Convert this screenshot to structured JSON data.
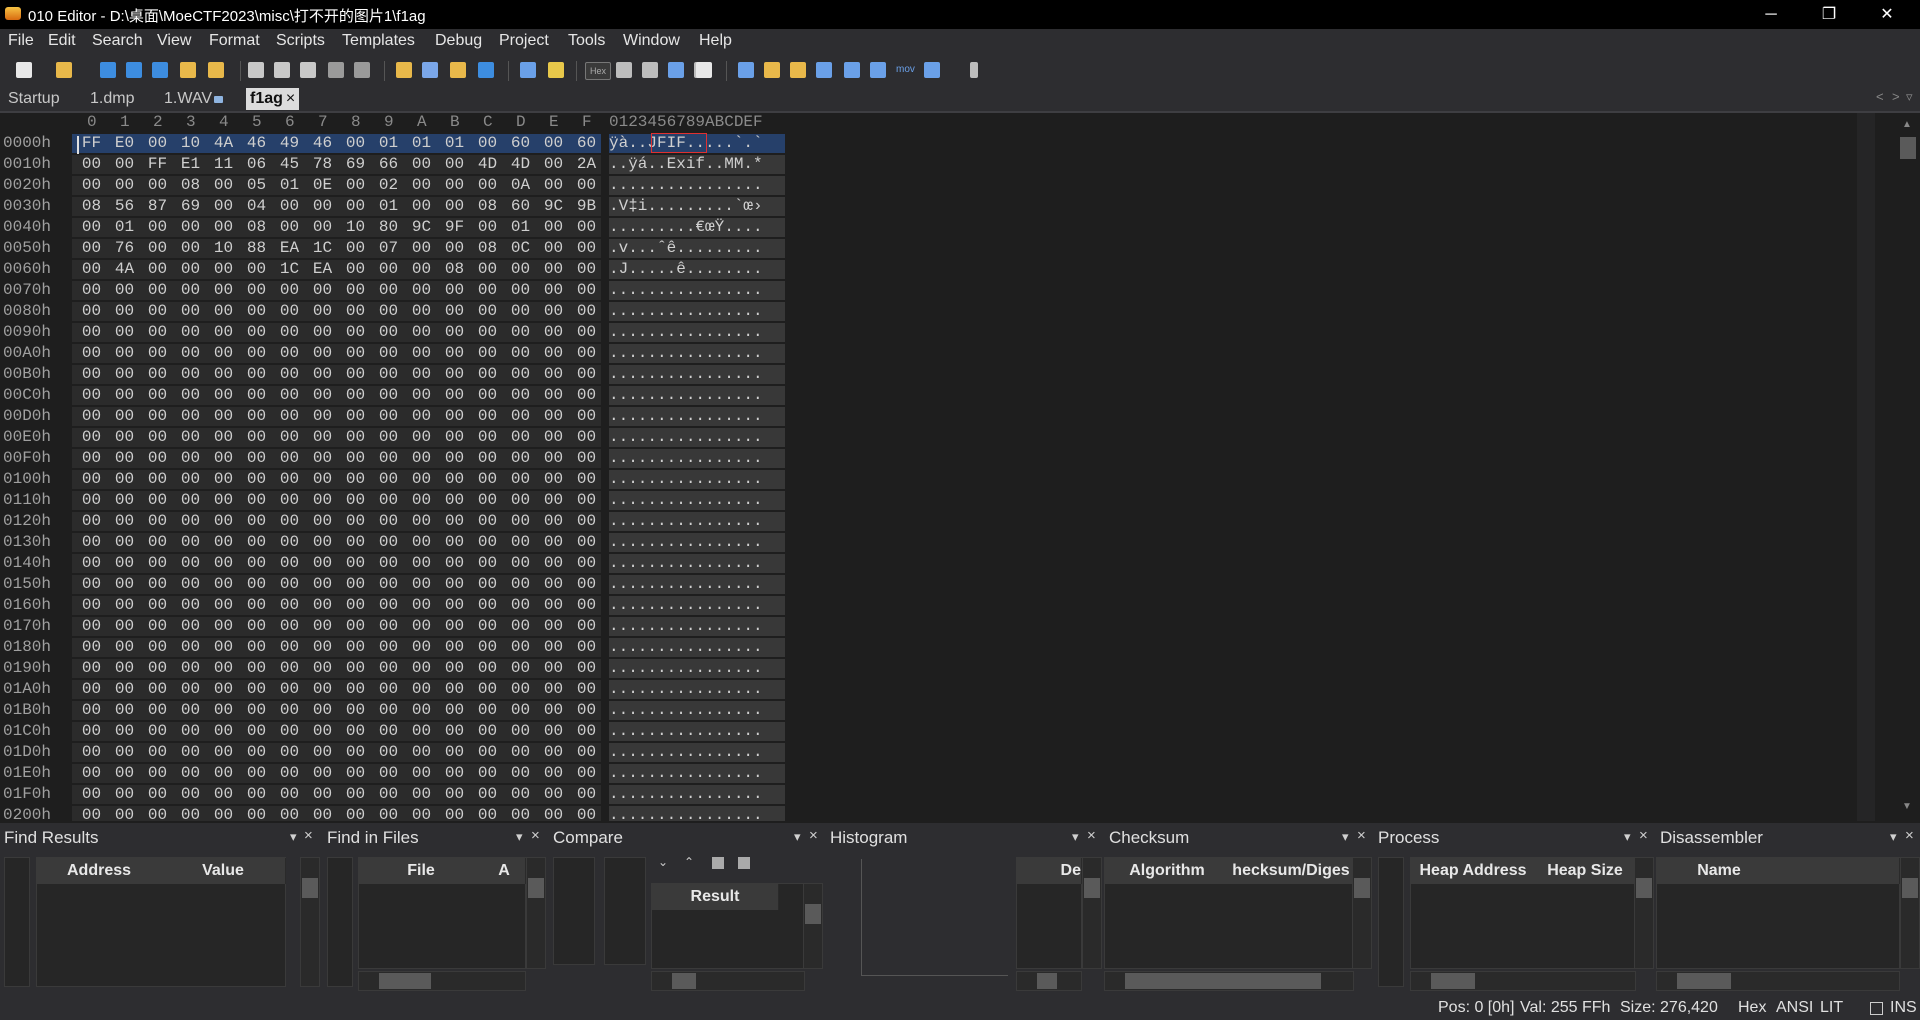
{
  "window": {
    "title": "010 Editor - D:\\桌面\\MoeCTF2023\\misc\\打不开的图片1\\f1ag",
    "minimize": "─",
    "restore": "❐",
    "close": "✕"
  },
  "menu": [
    "File",
    "Edit",
    "Search",
    "View",
    "Format",
    "Scripts",
    "Templates",
    "Debug",
    "Project",
    "Tools",
    "Window",
    "Help"
  ],
  "toolbar": {
    "hex_label": "Hex",
    "mov_label": "mov"
  },
  "tabs": [
    {
      "label": "Startup"
    },
    {
      "label": "1.dmp"
    },
    {
      "label": "1.WAV"
    },
    {
      "label": "f1ag",
      "close": "×"
    }
  ],
  "hex": {
    "columns": [
      "0",
      "1",
      "2",
      "3",
      "4",
      "5",
      "6",
      "7",
      "8",
      "9",
      "A",
      "B",
      "C",
      "D",
      "E",
      "F"
    ],
    "ascii_header": "0123456789ABCDEF",
    "rows": [
      {
        "addr": "0000h",
        "bytes": "FF E0 00 10 4A 46 49 46 00 01 01 01 00 60 00 60",
        "ascii": "ÿà..JFIF.....`.`"
      },
      {
        "addr": "0010h",
        "bytes": "00 00 FF E1 11 06 45 78 69 66 00 00 4D 4D 00 2A",
        "ascii": "..ÿá..Exif..MM.*"
      },
      {
        "addr": "0020h",
        "bytes": "00 00 00 08 00 05 01 0E 00 02 00 00 00 0A 00 00",
        "ascii": "................"
      },
      {
        "addr": "0030h",
        "bytes": "08 56 87 69 00 04 00 00 00 01 00 00 08 60 9C 9B",
        "ascii": ".V‡i.........`œ›"
      },
      {
        "addr": "0040h",
        "bytes": "00 01 00 00 00 08 00 00 10 80 9C 9F 00 01 00 00",
        "ascii": ".........€œŸ...."
      },
      {
        "addr": "0050h",
        "bytes": "00 76 00 00 10 88 EA 1C 00 07 00 00 08 0C 00 00",
        "ascii": ".v...ˆê........."
      },
      {
        "addr": "0060h",
        "bytes": "00 4A 00 00 00 00 1C EA 00 00 00 08 00 00 00 00",
        "ascii": ".J.....ê........"
      },
      {
        "addr": "0070h",
        "bytes": "00 00 00 00 00 00 00 00 00 00 00 00 00 00 00 00",
        "ascii": "................"
      },
      {
        "addr": "0080h",
        "bytes": "00 00 00 00 00 00 00 00 00 00 00 00 00 00 00 00",
        "ascii": "................"
      },
      {
        "addr": "0090h",
        "bytes": "00 00 00 00 00 00 00 00 00 00 00 00 00 00 00 00",
        "ascii": "................"
      },
      {
        "addr": "00A0h",
        "bytes": "00 00 00 00 00 00 00 00 00 00 00 00 00 00 00 00",
        "ascii": "................"
      },
      {
        "addr": "00B0h",
        "bytes": "00 00 00 00 00 00 00 00 00 00 00 00 00 00 00 00",
        "ascii": "................"
      },
      {
        "addr": "00C0h",
        "bytes": "00 00 00 00 00 00 00 00 00 00 00 00 00 00 00 00",
        "ascii": "................"
      },
      {
        "addr": "00D0h",
        "bytes": "00 00 00 00 00 00 00 00 00 00 00 00 00 00 00 00",
        "ascii": "................"
      },
      {
        "addr": "00E0h",
        "bytes": "00 00 00 00 00 00 00 00 00 00 00 00 00 00 00 00",
        "ascii": "................"
      },
      {
        "addr": "00F0h",
        "bytes": "00 00 00 00 00 00 00 00 00 00 00 00 00 00 00 00",
        "ascii": "................"
      },
      {
        "addr": "0100h",
        "bytes": "00 00 00 00 00 00 00 00 00 00 00 00 00 00 00 00",
        "ascii": "................"
      },
      {
        "addr": "0110h",
        "bytes": "00 00 00 00 00 00 00 00 00 00 00 00 00 00 00 00",
        "ascii": "................"
      },
      {
        "addr": "0120h",
        "bytes": "00 00 00 00 00 00 00 00 00 00 00 00 00 00 00 00",
        "ascii": "................"
      },
      {
        "addr": "0130h",
        "bytes": "00 00 00 00 00 00 00 00 00 00 00 00 00 00 00 00",
        "ascii": "................"
      },
      {
        "addr": "0140h",
        "bytes": "00 00 00 00 00 00 00 00 00 00 00 00 00 00 00 00",
        "ascii": "................"
      },
      {
        "addr": "0150h",
        "bytes": "00 00 00 00 00 00 00 00 00 00 00 00 00 00 00 00",
        "ascii": "................"
      },
      {
        "addr": "0160h",
        "bytes": "00 00 00 00 00 00 00 00 00 00 00 00 00 00 00 00",
        "ascii": "................"
      },
      {
        "addr": "0170h",
        "bytes": "00 00 00 00 00 00 00 00 00 00 00 00 00 00 00 00",
        "ascii": "................"
      },
      {
        "addr": "0180h",
        "bytes": "00 00 00 00 00 00 00 00 00 00 00 00 00 00 00 00",
        "ascii": "................"
      },
      {
        "addr": "0190h",
        "bytes": "00 00 00 00 00 00 00 00 00 00 00 00 00 00 00 00",
        "ascii": "................"
      },
      {
        "addr": "01A0h",
        "bytes": "00 00 00 00 00 00 00 00 00 00 00 00 00 00 00 00",
        "ascii": "................"
      },
      {
        "addr": "01B0h",
        "bytes": "00 00 00 00 00 00 00 00 00 00 00 00 00 00 00 00",
        "ascii": "................"
      },
      {
        "addr": "01C0h",
        "bytes": "00 00 00 00 00 00 00 00 00 00 00 00 00 00 00 00",
        "ascii": "................"
      },
      {
        "addr": "01D0h",
        "bytes": "00 00 00 00 00 00 00 00 00 00 00 00 00 00 00 00",
        "ascii": "................"
      },
      {
        "addr": "01E0h",
        "bytes": "00 00 00 00 00 00 00 00 00 00 00 00 00 00 00 00",
        "ascii": "................"
      },
      {
        "addr": "01F0h",
        "bytes": "00 00 00 00 00 00 00 00 00 00 00 00 00 00 00 00",
        "ascii": "................"
      },
      {
        "addr": "0200h",
        "bytes": "00 00 00 00 00 00 00 00 00 00 00 00 00 00 00 00",
        "ascii": "................"
      }
    ]
  },
  "panels": {
    "find_results": {
      "title": "Find Results",
      "cols": [
        "Address",
        "Value"
      ]
    },
    "find_in_files": {
      "title": "Find in Files",
      "cols": [
        "File",
        "A"
      ]
    },
    "compare": {
      "title": "Compare",
      "result": "Result"
    },
    "histogram": {
      "title": "Histogram"
    },
    "checksum": {
      "title": "Checksum",
      "col0": "De",
      "cols": [
        "Algorithm",
        "hecksum/Diges"
      ]
    },
    "process": {
      "title": "Process",
      "cols": [
        "Heap Address",
        "Heap Size"
      ]
    },
    "disassembler": {
      "title": "Disassembler",
      "cols": [
        "Name"
      ]
    },
    "close_glyph": "×",
    "menu_glyph": "▾"
  },
  "status": {
    "pos": "Pos: 0 [0h]",
    "val": "Val: 255 FFh",
    "size": "Size: 276,420",
    "hex": "Hex",
    "ansi": "ANSI",
    "lit": "LIT",
    "ins": "INS"
  },
  "colors": {
    "selection": "#26406a",
    "accent": "#e03030"
  }
}
